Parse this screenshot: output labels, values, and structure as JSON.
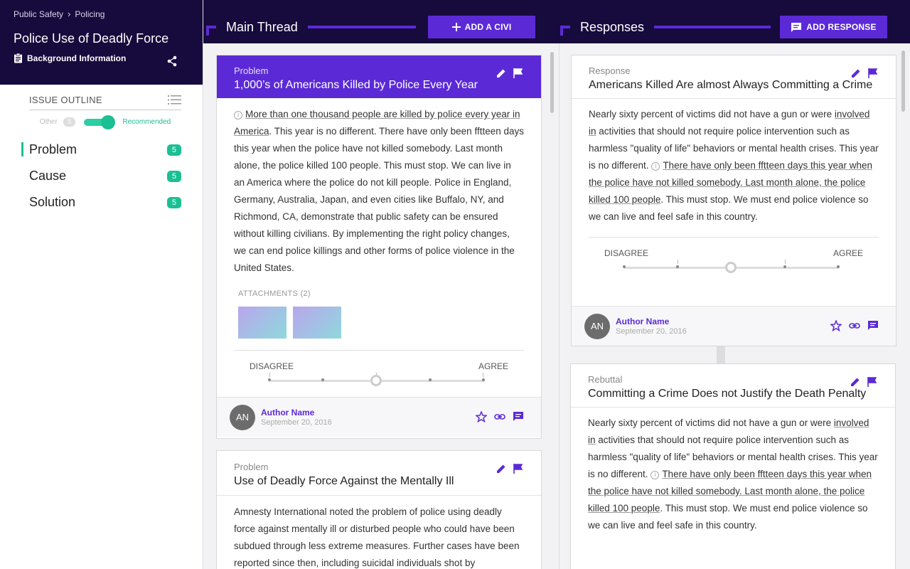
{
  "sidebar": {
    "breadcrumbs": [
      "Public Safety",
      "Policing"
    ],
    "issue_title": "Police Use of Deadly Force",
    "background_info": "Background Information",
    "outline_title": "ISSUE OUTLINE",
    "toggle_other": "Other",
    "toggle_other_count": "5",
    "toggle_recommended": "Recommended",
    "items": [
      {
        "label": "Problem",
        "count": "5"
      },
      {
        "label": "Cause",
        "count": "5"
      },
      {
        "label": "Solution",
        "count": "5"
      }
    ]
  },
  "main": {
    "title": "Main Thread",
    "add_label": "ADD A CIVI",
    "cards": [
      {
        "type": "Problem",
        "title": "1,000’s of Americans Killed by Police Every Year",
        "body_link": "More than one thousand people are killed by police every year in America",
        "body_rest": ". This year is no different. There have only been fftteen days this year when the police have not killed somebody. Last month alone, the police killed 100 people. This must stop. We can live in an America where the police do not kill people. Police in England, Germany, Australia, Japan, and even cities like Buffalo, NY, and Richmond, CA, demonstrate that public safety can be ensured without killing civilians. By implementing the right policy changes, we can end police killings and other forms of police violence in the United States.",
        "attachments_label": "ATTACHMENTS (2)",
        "disagree": "DISAGREE",
        "agree": "AGREE",
        "author_initials": "AN",
        "author_name": "Author Name",
        "date": "September 20, 2016"
      },
      {
        "type": "Problem",
        "title": "Use of Deadly Force Against the Mentally Ill",
        "body": "Amnesty International noted the problem of police using deadly force against mentally ill or disturbed people who could have been subdued through less extreme measures. Further cases have been reported since then, including suicidal individuals shot by"
      }
    ]
  },
  "responses": {
    "title": "Responses",
    "add_label": "ADD RESPONSE",
    "cards": [
      {
        "type": "Response",
        "title": "Americans Killed Are almost Always Committing a Crime",
        "body_a": "Nearly sixty percent of victims did not have a gun or were ",
        "body_a_link": "involved in",
        "body_b": " activities that should not require police intervention such as harmless \"quality of life\" behaviors or mental health crises. This year is no different. ",
        "body_c_link": "There have only been fftteen days this year when the police have not killed somebody. Last month alone, the police killed 100 people",
        "body_d": ". This must stop. We must end police violence so we can live and feel safe in this country.",
        "disagree": "DISAGREE",
        "agree": "AGREE",
        "author_initials": "AN",
        "author_name": "Author Name",
        "date": "September 20, 2016"
      },
      {
        "type": "Rebuttal",
        "title": "Committing a Crime Does not Justify the Death Penalty",
        "body_a": "Nearly sixty percent of victims did not have a gun or were ",
        "body_a_link": "involved in",
        "body_b": " activities that should not require police intervention such as harmless \"quality of life\" behaviors or mental health crises. This year is no different. ",
        "body_c_link": "There have only been fftteen days this year when the police have not killed somebody. Last month alone, the police killed 100 people",
        "body_d": ". This must stop. We must end police violence so we can live and feel safe in this country."
      }
    ]
  },
  "colors": {
    "header": "#170a3c",
    "accent": "#5b2ad6",
    "teal": "#1bbf94"
  },
  "icons": [
    "document-icon",
    "share-icon",
    "list-icon",
    "plus-icon",
    "chat-icon",
    "pencil-icon",
    "flag-icon",
    "star-icon",
    "link-icon",
    "comment-icon",
    "info-icon"
  ]
}
